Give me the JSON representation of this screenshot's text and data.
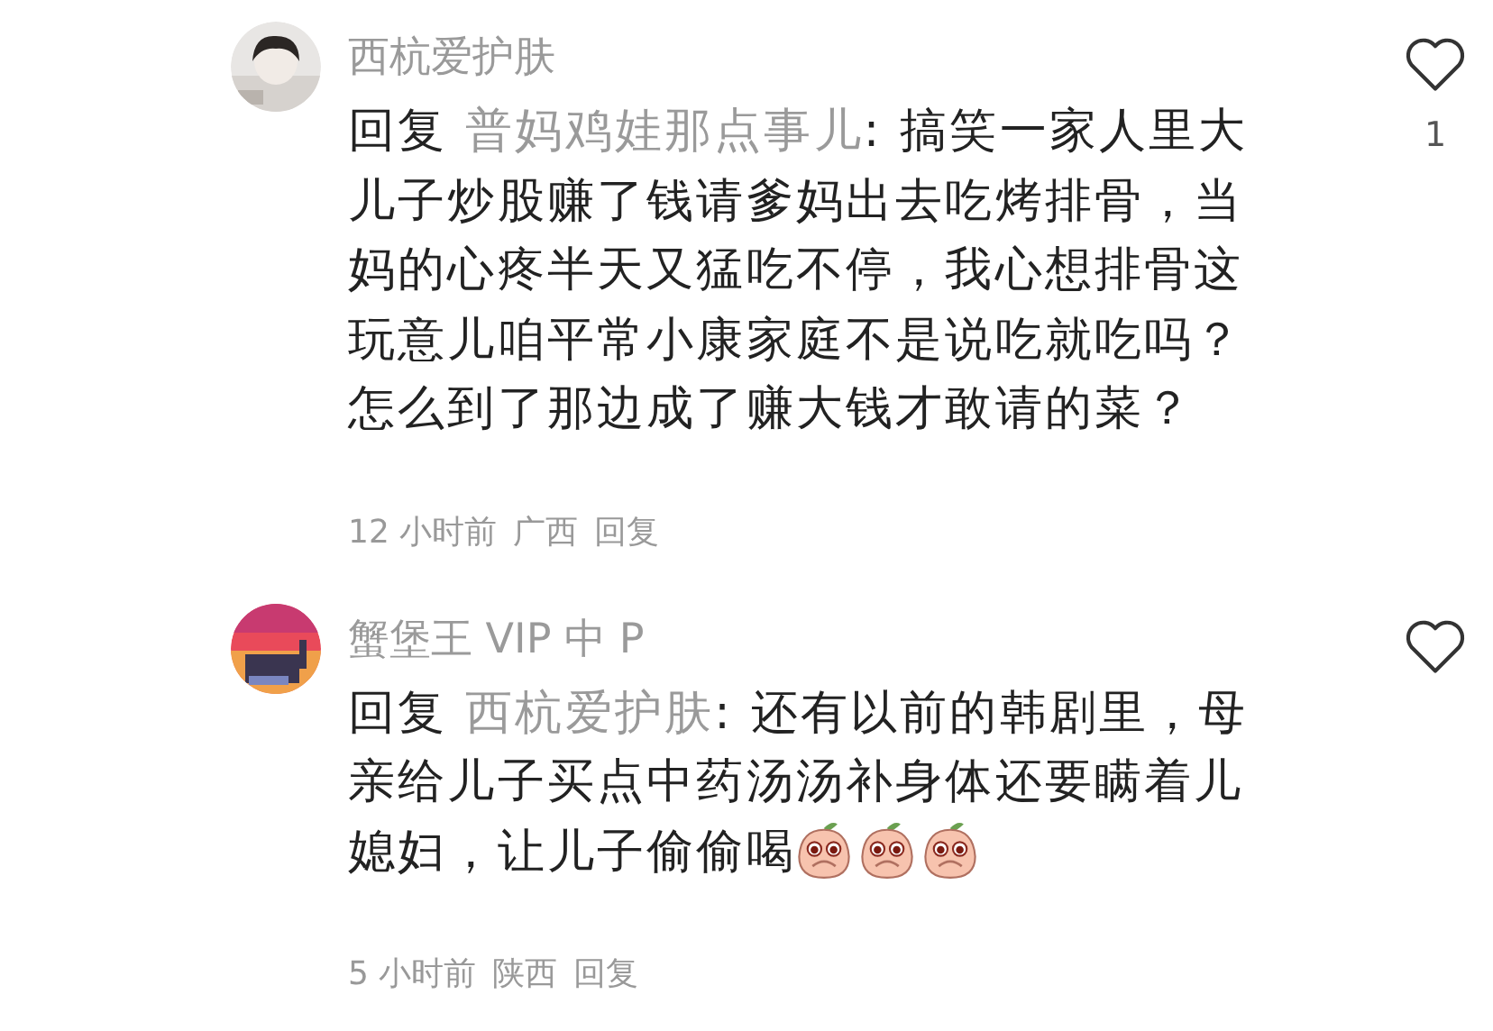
{
  "comments": [
    {
      "name": "西杭爱护肤",
      "liked": false,
      "like_count": "1",
      "reply_label": "回复",
      "reply_to": "普妈鸡娃那点事儿",
      "text": ": 搞笑一家人里大儿子炒股赚了钱请爹妈出去吃烤排骨，当妈的心疼半天又猛吃不停，我心想排骨这玩意儿咱平常小康家庭不是说吃就吃吗？怎么到了那边成了赚大钱才敢请的菜？",
      "time": "12 小时前",
      "location": "广西",
      "reply_action": "回复"
    },
    {
      "name": "蟹堡王 VIP 中 P",
      "liked": false,
      "reply_label": "回复",
      "reply_to": "西杭爱护肤",
      "text": ": 还有以前的韩剧里，母亲给儿子买点中药汤汤补身体还要瞒着儿媳妇，让儿子偷偷喝",
      "emojis": [
        {
          "kind": "peach"
        },
        {
          "kind": "peach"
        },
        {
          "kind": "peach"
        }
      ],
      "time": "5 小时前",
      "location": "陕西",
      "reply_action": "回复"
    }
  ]
}
